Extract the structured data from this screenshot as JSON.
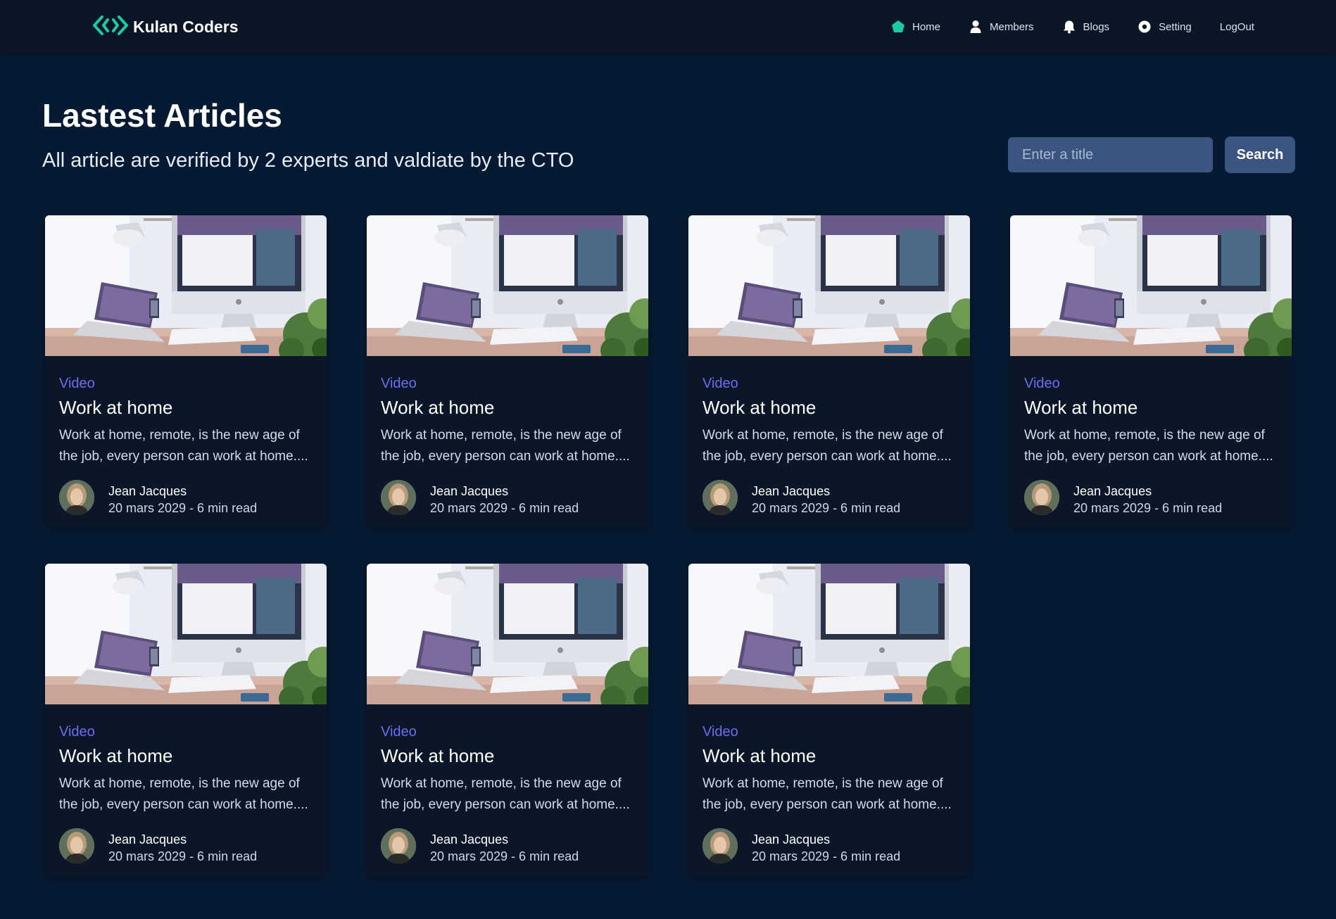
{
  "navbar": {
    "brand": "Kulan Coders",
    "items": [
      {
        "label": "Home",
        "icon": "home-icon"
      },
      {
        "label": "Members",
        "icon": "user-icon"
      },
      {
        "label": "Blogs",
        "icon": "bell-icon"
      },
      {
        "label": "Setting",
        "icon": "settings-icon"
      },
      {
        "label": "LogOut"
      }
    ]
  },
  "header": {
    "title": "Lastest Articles",
    "subtitle": "All article are verified by 2 experts and valdiate by the CTO"
  },
  "search": {
    "placeholder": "Enter a title",
    "button_label": "Search"
  },
  "articles": [
    {
      "category": "Video",
      "title": "Work at home",
      "excerpt_line1": "Work at home, remote, is the new age of",
      "excerpt_line2": "the job, every person can work at home....",
      "author": "Jean Jacques",
      "meta": "20 mars 2029 - 6 min read"
    },
    {
      "category": "Video",
      "title": "Work at home",
      "excerpt_line1": "Work at home, remote, is the new age of",
      "excerpt_line2": "the job, every person can work at home....",
      "author": "Jean Jacques",
      "meta": "20 mars 2029 - 6 min read"
    },
    {
      "category": "Video",
      "title": "Work at home",
      "excerpt_line1": "Work at home, remote, is the new age of",
      "excerpt_line2": "the job, every person can work at home....",
      "author": "Jean Jacques",
      "meta": "20 mars 2029 - 6 min read"
    },
    {
      "category": "Video",
      "title": "Work at home",
      "excerpt_line1": "Work at home, remote, is the new age of",
      "excerpt_line2": "the job, every person can work at home....",
      "author": "Jean Jacques",
      "meta": "20 mars 2029 - 6 min read"
    },
    {
      "category": "Video",
      "title": "Work at home",
      "excerpt_line1": "Work at home, remote, is the new age of",
      "excerpt_line2": "the job, every person can work at home....",
      "author": "Jean Jacques",
      "meta": "20 mars 2029 - 6 min read"
    },
    {
      "category": "Video",
      "title": "Work at home",
      "excerpt_line1": "Work at home, remote, is the new age of",
      "excerpt_line2": "the job, every person can work at home....",
      "author": "Jean Jacques",
      "meta": "20 mars 2029 - 6 min read"
    },
    {
      "category": "Video",
      "title": "Work at home",
      "excerpt_line1": "Work at home, remote, is the new age of",
      "excerpt_line2": "the job, every person can work at home....",
      "author": "Jean Jacques",
      "meta": "20 mars 2029 - 6 min read"
    }
  ],
  "colors": {
    "background": "#071a33",
    "navbar": "#0a1626",
    "card": "#0b1628",
    "accent_brand": "#1ec8a0",
    "category": "#6f6cf0",
    "search_control": "#3b5580"
  }
}
